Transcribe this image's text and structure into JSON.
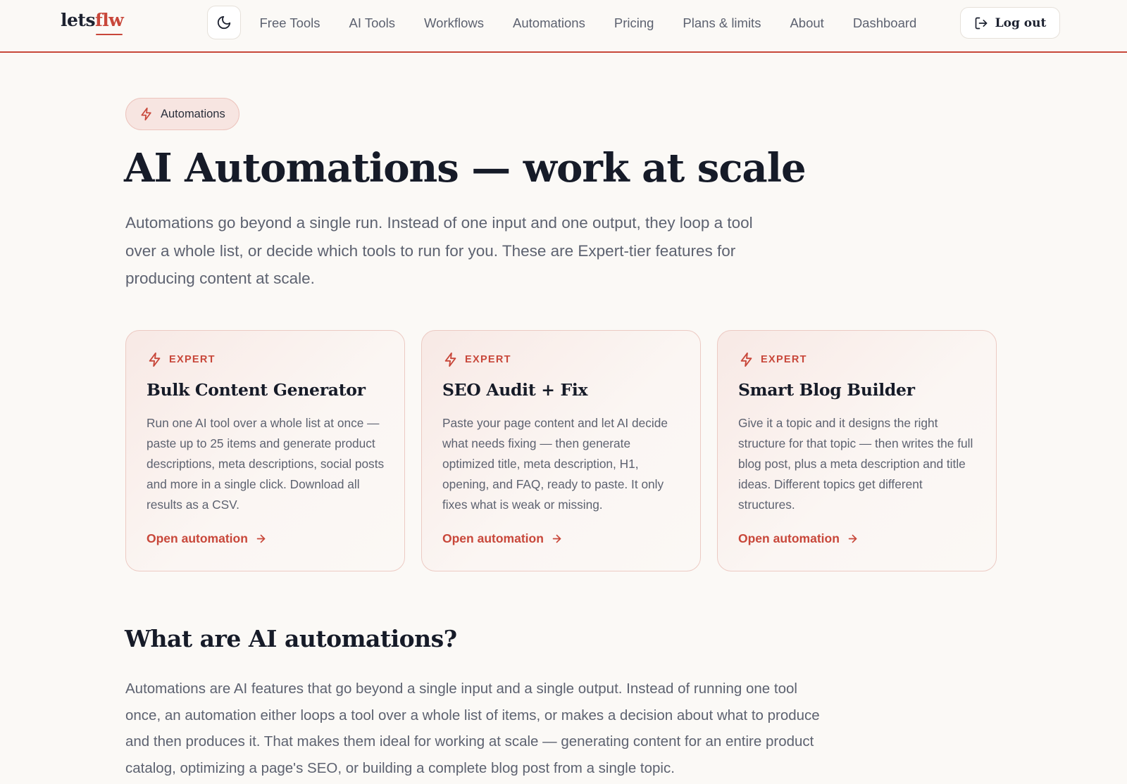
{
  "nav": {
    "logo_main": "lets",
    "logo_accent": "flw",
    "theme_toggle_icon": "moon-icon",
    "links": [
      {
        "label": "Free Tools"
      },
      {
        "label": "AI Tools"
      },
      {
        "label": "Workflows"
      },
      {
        "label": "Automations"
      },
      {
        "label": "Pricing"
      },
      {
        "label": "Plans & limits"
      },
      {
        "label": "About"
      },
      {
        "label": "Dashboard"
      }
    ],
    "logout_label": "Log out",
    "logout_icon": "logout-icon"
  },
  "hero": {
    "pill_icon": "lightning-icon",
    "pill_label": "Automations",
    "title": "AI Automations — work at scale",
    "subtitle": "Automations go beyond a single run. Instead of one input and one output, they loop a tool over a whole list, or decide which tools to run for you. These are Expert-tier features for producing content at scale."
  },
  "cards": [
    {
      "badge": "EXPERT",
      "title": "Bulk Content Generator",
      "description": "Run one AI tool over a whole list at once — paste up to 25 items and generate product descriptions, meta descriptions, social posts and more in a single click. Download all results as a CSV.",
      "link_label": "Open automation"
    },
    {
      "badge": "EXPERT",
      "title": "SEO Audit + Fix",
      "description": "Paste your page content and let AI decide what needs fixing — then generate optimized title, meta description, H1, opening, and FAQ, ready to paste. It only fixes what is weak or missing.",
      "link_label": "Open automation"
    },
    {
      "badge": "EXPERT",
      "title": "Smart Blog Builder",
      "description": "Give it a topic and it designs the right structure for that topic — then writes the full blog post, plus a meta description and title ideas. Different topics get different structures.",
      "link_label": "Open automation"
    }
  ],
  "section": {
    "title": "What are AI automations?",
    "body": "Automations are AI features that go beyond a single input and a single output. Instead of running one tool once, an automation either loops a tool over a whole list of items, or makes a decision about what to produce and then produces it. That makes them ideal for working at scale — generating content for an entire product catalog, optimizing a page's SEO, or building a complete blog post from a single topic."
  },
  "colors": {
    "accent": "#c8473a",
    "background": "#fbf9f6",
    "heading": "#161b28",
    "body_text": "#5d6270",
    "card_border": "#eccac3",
    "pill_background": "#f7e5e1"
  }
}
